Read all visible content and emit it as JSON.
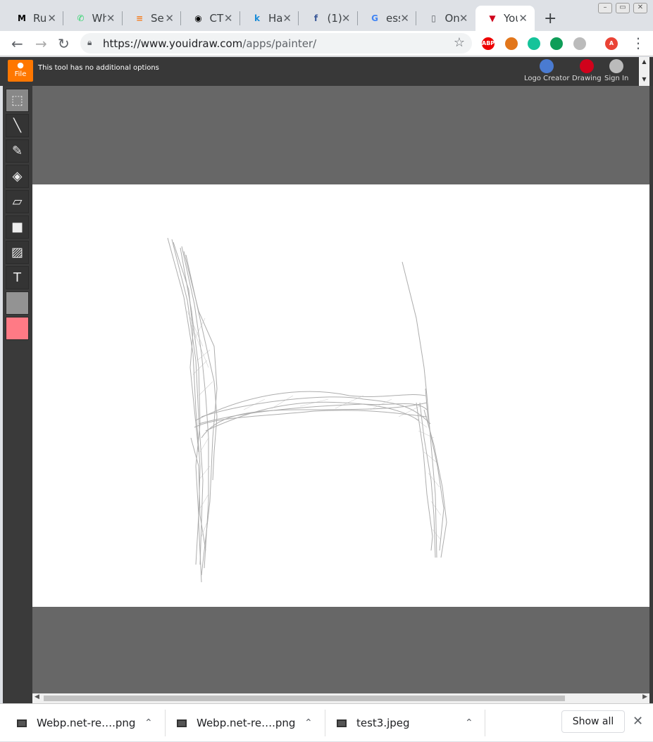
{
  "tabs": [
    {
      "title": "Run",
      "favicon": "M",
      "icon": "medium-icon",
      "color": "#000000"
    },
    {
      "title": "Wh",
      "favicon": "✆",
      "icon": "whatsapp-icon",
      "color": "#25d366"
    },
    {
      "title": "Ser",
      "favicon": "≡",
      "icon": "stackoverflow-icon",
      "color": "#f48024"
    },
    {
      "title": "CTI",
      "favicon": "◉",
      "icon": "github-icon",
      "color": "#000000"
    },
    {
      "title": "Ha",
      "favicon": "k",
      "icon": "k-icon",
      "color": "#1a8cd8"
    },
    {
      "title": "(1)",
      "favicon": "f",
      "icon": "facebook-icon",
      "color": "#3b5998"
    },
    {
      "title": "ess",
      "favicon": "G",
      "icon": "google-icon",
      "color": "#4285f4"
    },
    {
      "title": "On",
      "favicon": "▯",
      "icon": "page-icon",
      "color": "#5f6368"
    },
    {
      "title": "You",
      "favicon": "▼",
      "icon": "youidraw-icon",
      "color": "#d0021b"
    }
  ],
  "url": {
    "host": "https://www.youidraw.com",
    "path": "/apps/painter/"
  },
  "extensions": [
    {
      "name": "adblock-icon",
      "label": "ABP",
      "color": "#e00"
    },
    {
      "name": "metamask-icon",
      "label": "",
      "color": "#e2761b"
    },
    {
      "name": "grammarly-icon",
      "label": "",
      "color": "#15c39a"
    },
    {
      "name": "hangouts-icon",
      "label": "",
      "color": "#0f9d58"
    },
    {
      "name": "docs-icon",
      "label": "",
      "color": "#bbb"
    },
    {
      "name": "profile-avatar",
      "label": "A",
      "color": "#ea4335"
    }
  ],
  "app": {
    "file_label": "File",
    "tool_options": "This tool has no additional options",
    "header_links": [
      {
        "label": "Logo Creator",
        "icon": "logo-creator-icon",
        "color": "#4a7bd1"
      },
      {
        "label": "Drawing",
        "icon": "drawing-icon",
        "color": "#d0021b"
      },
      {
        "label": "Sign In",
        "icon": "user-icon",
        "color": "#bbbbbb"
      }
    ],
    "tools": [
      {
        "name": "select-tool",
        "glyph": "⬚"
      },
      {
        "name": "pencil-tool",
        "glyph": "╲"
      },
      {
        "name": "brush-tool",
        "glyph": "✎"
      },
      {
        "name": "fill-tool",
        "glyph": "◈"
      },
      {
        "name": "eraser-tool",
        "glyph": "▱"
      },
      {
        "name": "rectangle-tool",
        "glyph": "■"
      },
      {
        "name": "image-tool",
        "glyph": "▨"
      },
      {
        "name": "text-tool",
        "glyph": "T"
      }
    ],
    "primary_color": "#939393",
    "secondary_color": "#ff7a85"
  },
  "downloads": [
    {
      "name": "Webp.net-re….png"
    },
    {
      "name": "Webp.net-re….png"
    },
    {
      "name": "test3.jpeg"
    }
  ],
  "show_all_label": "Show all"
}
